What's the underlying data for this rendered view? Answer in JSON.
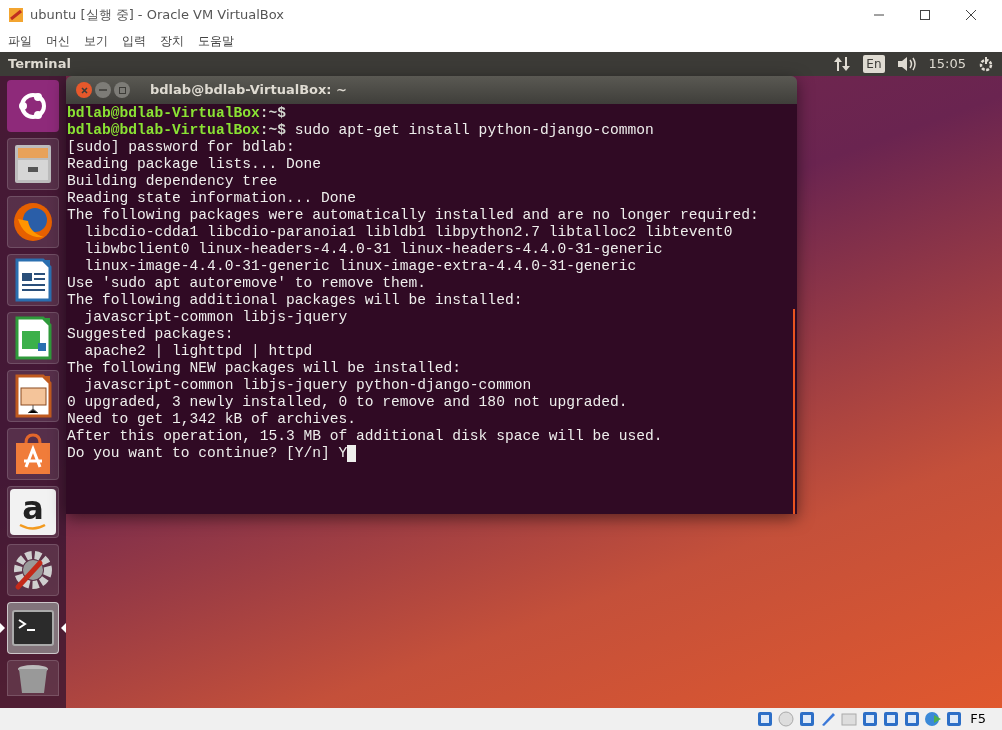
{
  "window": {
    "title": "ubuntu [실행 중] - Oracle VM VirtualBox"
  },
  "menu": [
    "파일",
    "머신",
    "보기",
    "입력",
    "장치",
    "도움말"
  ],
  "top_panel": {
    "app_name": "Terminal",
    "keyboard": "En",
    "time": "15:05"
  },
  "launcher": [
    {
      "kind": "dash",
      "active": false
    },
    {
      "kind": "files",
      "active": false
    },
    {
      "kind": "browser",
      "active": false
    },
    {
      "kind": "writer",
      "active": false
    },
    {
      "kind": "calc",
      "active": false
    },
    {
      "kind": "impress",
      "active": false
    },
    {
      "kind": "store",
      "active": false
    },
    {
      "kind": "amazon",
      "label": "a",
      "active": false
    },
    {
      "kind": "settings",
      "active": false
    },
    {
      "kind": "terminal",
      "active": true
    },
    {
      "kind": "trash",
      "active": false
    }
  ],
  "terminal": {
    "title": "bdlab@bdlab-VirtualBox: ~",
    "lines": [
      {
        "kind": "prompt",
        "user": "bdlab@bdlab-VirtualBox",
        "path": ":~$"
      },
      {
        "kind": "prompt",
        "user": "bdlab@bdlab-VirtualBox",
        "path": ":~$",
        "text": " sudo apt-get install python-django-common"
      },
      {
        "kind": "output",
        "text": "[sudo] password for bdlab:"
      },
      {
        "kind": "output",
        "text": "Reading package lists... Done"
      },
      {
        "kind": "output",
        "text": "Building dependency tree"
      },
      {
        "kind": "output",
        "text": "Reading state information... Done"
      },
      {
        "kind": "output",
        "text": "The following packages were automatically installed and are no longer required:"
      },
      {
        "kind": "output",
        "text": "  libcdio-cdda1 libcdio-paranoia1 libldb1 libpython2.7 libtalloc2 libtevent0"
      },
      {
        "kind": "output",
        "text": "  libwbclient0 linux-headers-4.4.0-31 linux-headers-4.4.0-31-generic"
      },
      {
        "kind": "output",
        "text": "  linux-image-4.4.0-31-generic linux-image-extra-4.4.0-31-generic"
      },
      {
        "kind": "output",
        "text": "Use 'sudo apt autoremove' to remove them."
      },
      {
        "kind": "output",
        "text": "The following additional packages will be installed:"
      },
      {
        "kind": "output",
        "text": "  javascript-common libjs-jquery"
      },
      {
        "kind": "output",
        "text": "Suggested packages:"
      },
      {
        "kind": "output",
        "text": "  apache2 | lighttpd | httpd"
      },
      {
        "kind": "output",
        "text": "The following NEW packages will be installed:"
      },
      {
        "kind": "output",
        "text": "  javascript-common libjs-jquery python-django-common"
      },
      {
        "kind": "output",
        "text": "0 upgraded, 3 newly installed, 0 to remove and 180 not upgraded."
      },
      {
        "kind": "output",
        "text": "Need to get 1,342 kB of archives."
      },
      {
        "kind": "output",
        "text": "After this operation, 15.3 MB of additional disk space will be used."
      },
      {
        "kind": "input",
        "text": "Do you want to continue? [Y/n] Y"
      }
    ]
  },
  "status_bar": {
    "host_key": "F5"
  }
}
